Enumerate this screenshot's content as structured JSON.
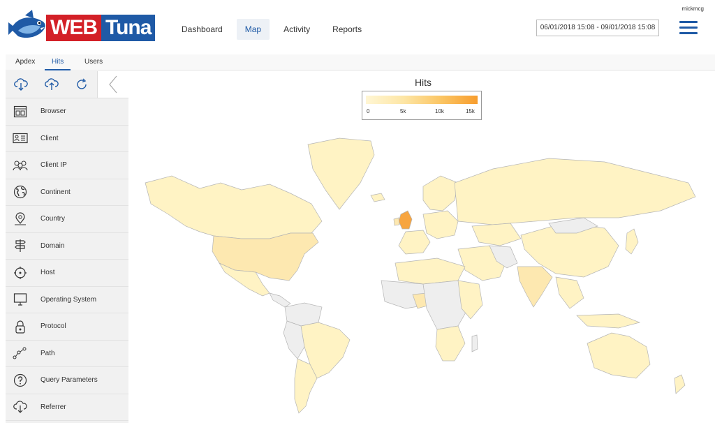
{
  "brand": {
    "word1": "WEB",
    "word2": "Tuna"
  },
  "user": {
    "name": "mickmcg"
  },
  "nav": {
    "items": [
      "Dashboard",
      "Map",
      "Activity",
      "Reports"
    ],
    "active": "Map"
  },
  "date_range": "06/01/2018 15:08 - 09/01/2018 15:08",
  "subtabs": {
    "items": [
      "Apdex",
      "Hits",
      "Users"
    ],
    "active": "Hits"
  },
  "sidebar": {
    "tools": [
      "cloud-download-icon",
      "cloud-upload-icon",
      "refresh-icon",
      "chevron-left-icon"
    ],
    "items": [
      {
        "label": "Browser",
        "icon": "browser-icon"
      },
      {
        "label": "Client",
        "icon": "client-icon"
      },
      {
        "label": "Client IP",
        "icon": "client-ip-icon"
      },
      {
        "label": "Continent",
        "icon": "globe-icon"
      },
      {
        "label": "Country",
        "icon": "location-pin-icon"
      },
      {
        "label": "Domain",
        "icon": "signpost-icon"
      },
      {
        "label": "Host",
        "icon": "target-icon"
      },
      {
        "label": "Operating System",
        "icon": "monitor-icon"
      },
      {
        "label": "Protocol",
        "icon": "lock-icon"
      },
      {
        "label": "Path",
        "icon": "path-icon"
      },
      {
        "label": "Query Parameters",
        "icon": "question-icon"
      },
      {
        "label": "Referrer",
        "icon": "cloud-referrer-icon"
      }
    ]
  },
  "map": {
    "title": "Hits",
    "legend_ticks": [
      "0",
      "5k",
      "10k",
      "15k"
    ],
    "colors": {
      "none": "#eeeeee",
      "low": "#fff3c4",
      "mid": "#fddf9a",
      "high": "#f7a540",
      "border": "#b5b5b5"
    }
  }
}
